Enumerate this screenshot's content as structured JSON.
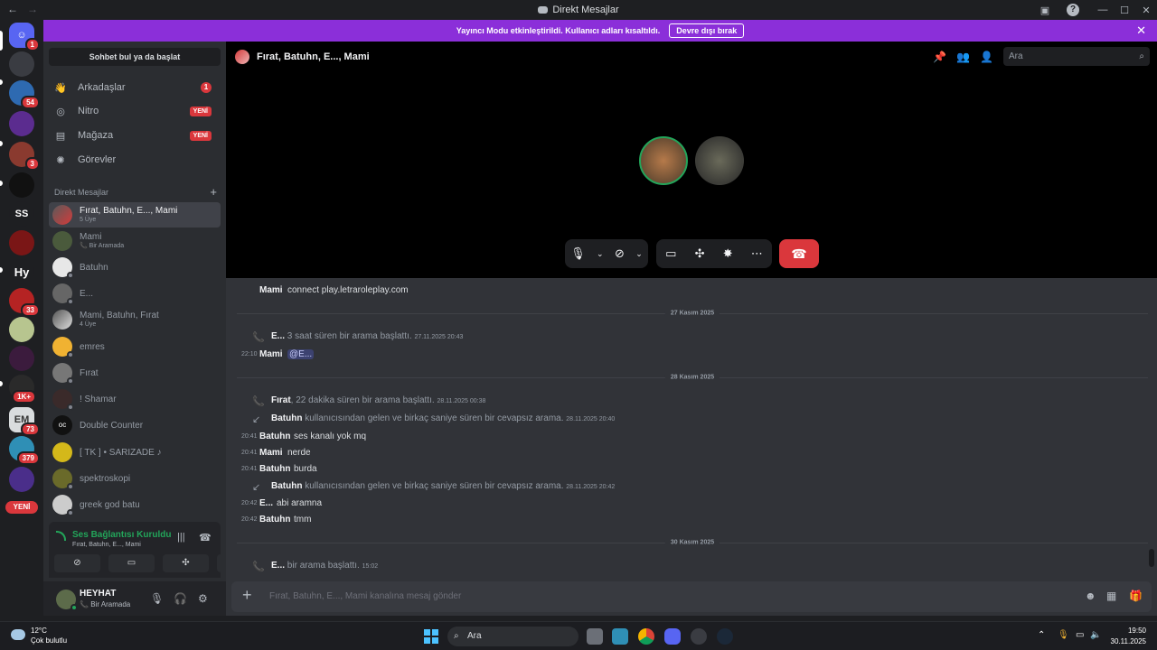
{
  "window": {
    "title": "Direkt Mesajlar"
  },
  "banner": {
    "text": "Yayıncı Modu etkinleştirildi. Kullanıcı adları kısaltıldı.",
    "button": "Devre dışı bırak"
  },
  "rail": {
    "servers": [
      {
        "label": "",
        "badge": "1"
      },
      {
        "label": "",
        "badge": ""
      },
      {
        "label": "",
        "badge": "54"
      },
      {
        "label": "",
        "badge": ""
      },
      {
        "label": "",
        "badge": "3"
      },
      {
        "label": "",
        "badge": ""
      },
      {
        "label": "SS",
        "badge": ""
      },
      {
        "label": "",
        "badge": ""
      },
      {
        "label": "Hy",
        "badge": ""
      },
      {
        "label": "",
        "badge": "33"
      },
      {
        "label": "",
        "badge": ""
      },
      {
        "label": "",
        "badge": ""
      },
      {
        "label": "",
        "badge": "1K+"
      },
      {
        "label": "EM",
        "badge": "73"
      },
      {
        "label": "",
        "badge": "379"
      },
      {
        "label": "",
        "badge": ""
      }
    ],
    "new_label": "YENİ"
  },
  "sidebar": {
    "search_label": "Sohbet bul ya da başlat",
    "nav": [
      {
        "label": "Arkadaşlar",
        "count": "1",
        "tag": ""
      },
      {
        "label": "Nitro",
        "count": "",
        "tag": "YENİ"
      },
      {
        "label": "Mağaza",
        "count": "",
        "tag": "YENİ"
      },
      {
        "label": "Görevler",
        "count": "",
        "tag": ""
      }
    ],
    "dm_header": "Direkt Mesajlar",
    "dms": [
      {
        "name": "Fırat, Batuhn, E..., Mami",
        "sub": "5 Üye"
      },
      {
        "name": "Mami",
        "sub": "Bir Aramada"
      },
      {
        "name": "Batuhn",
        "sub": ""
      },
      {
        "name": "E...",
        "sub": ""
      },
      {
        "name": "Mami, Batuhn, Fırat",
        "sub": "4 Üye"
      },
      {
        "name": "emres",
        "sub": ""
      },
      {
        "name": "Fırat",
        "sub": ""
      },
      {
        "name": "! Shamar",
        "sub": ""
      },
      {
        "name": "Double Counter",
        "sub": ""
      },
      {
        "name": "[ TK ] • SARIZADE ♪",
        "sub": ""
      },
      {
        "name": "spektroskopi",
        "sub": ""
      },
      {
        "name": "greek god batu",
        "sub": ""
      }
    ]
  },
  "voice": {
    "status": "Ses Bağlantısı Kuruldu",
    "channel": "Fırat, Batuhn, E..., Mami"
  },
  "user": {
    "name": "HEYHAT",
    "status": "Bir Aramada"
  },
  "chat": {
    "title": "Fırat, Batuhn, E..., Mami",
    "search_placeholder": "Ara",
    "composer_placeholder": "Fırat, Batuhn, E..., Mami kanalına mesaj gönder",
    "top_message": {
      "author": "Mami",
      "text": "connect play.letraroleplay.com"
    },
    "day1": "27 Kasım 2025",
    "call1": {
      "who": "E...",
      "text": "3 saat süren bir arama başlattı.",
      "ts": "27.11.2025 20:43"
    },
    "msg1": {
      "time": "22:10",
      "author": "Mami",
      "text": "@E..."
    },
    "day2": "28 Kasım 2025",
    "call2": {
      "who": "Fırat",
      "text": ", 22 dakika süren bir arama başlattı.",
      "ts": "28.11.2025 00:38"
    },
    "missed1": {
      "who": "Batuhn",
      "text": "kullanıcısından gelen ve birkaç saniye süren bir cevapsız arama.",
      "ts": "28.11.2025 20:40"
    },
    "m2": {
      "time": "20:41",
      "author": "Batuhn",
      "text": "ses kanalı yok mq"
    },
    "m3": {
      "time": "20:41",
      "author": "Mami",
      "text": "nerde"
    },
    "m4": {
      "time": "20:41",
      "author": "Batuhn",
      "text": "burda"
    },
    "missed2": {
      "who": "Batuhn",
      "text": "kullanıcısından gelen ve birkaç saniye süren bir cevapsız arama.",
      "ts": "28.11.2025 20:42"
    },
    "m5": {
      "time": "20:42",
      "author": "E...",
      "text": "abi aramna"
    },
    "m6": {
      "time": "20:42",
      "author": "Batuhn",
      "text": "tmm"
    },
    "day3": "30 Kasım 2025",
    "call3": {
      "who": "E...",
      "text": "bir arama başlattı.",
      "ts": "15:02"
    }
  },
  "taskbar": {
    "temp": "12°C",
    "weather": "Çok bulutlu",
    "search": "Ara",
    "time": "19:50",
    "date": "30.11.2025"
  }
}
